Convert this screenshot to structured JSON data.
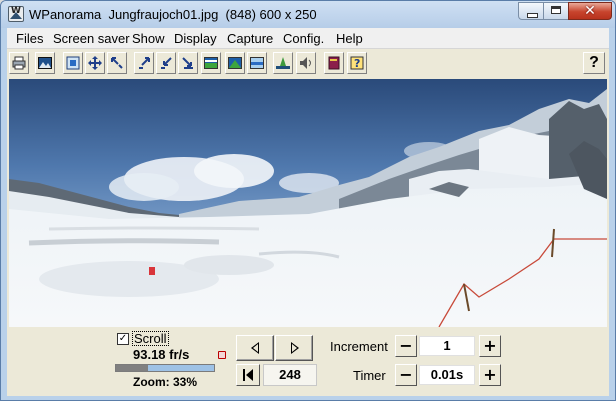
{
  "window": {
    "title": "WPanorama  Jungfraujoch01.jpg  (848) 600 x 250",
    "close_glyph": "✕"
  },
  "menu": [
    "Files",
    "Screen saver",
    "Show",
    "Display",
    "Capture",
    "Config.",
    "Help"
  ],
  "toolbar": {
    "buttons": [
      "print-icon",
      "open-image-icon",
      "fit-icon",
      "move-icon",
      "shrink-icon",
      "expand-corner-icon",
      "collapse-corner-icon",
      "resize-down-icon",
      "image-top-icon",
      "image-middle-icon",
      "image-bottom-icon",
      "horizon-icon",
      "sound-icon",
      "book-icon",
      "help-topics-icon"
    ],
    "help_label": "?"
  },
  "controls": {
    "scroll_checked": true,
    "scroll_check_glyph": "✓",
    "scroll_label": "Scroll",
    "fps": "93.18 fr/s",
    "zoom_label": "Zoom: 33%",
    "zoom_percent": 33,
    "position": "248",
    "increment_label": "Increment",
    "increment_value": "1",
    "timer_label": "Timer",
    "timer_value": "0.01s",
    "minus": "−",
    "plus": "+"
  }
}
